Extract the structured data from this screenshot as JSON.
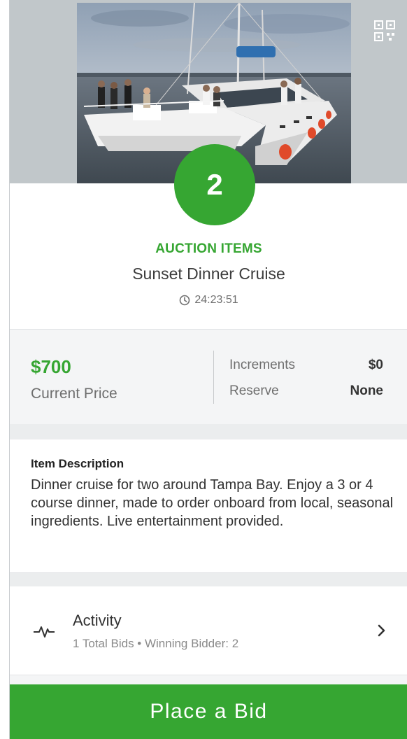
{
  "hero": {
    "image_alt": "Catamaran sailboat with guests dining on deck",
    "qr_icon": "qr-code-icon"
  },
  "item": {
    "number": "2",
    "category": "AUCTION ITEMS",
    "title": "Sunset Dinner Cruise",
    "time_remaining": "24:23:51",
    "timer_icon": "clock-icon"
  },
  "pricing": {
    "current_price": "$700",
    "current_price_label": "Current Price",
    "increments_label": "Increments",
    "increments_value": "$0",
    "reserve_label": "Reserve",
    "reserve_value": "None"
  },
  "description": {
    "heading": "Item Description",
    "body": "Dinner cruise for two around Tampa Bay. Enjoy a 3 or 4 course dinner, made to order onboard from local, seasonal ingredients. Live entertainment provided."
  },
  "activity": {
    "icon": "pulse-icon",
    "title": "Activity",
    "summary": "1 Total Bids • Winning Bidder: 2"
  },
  "actions": {
    "place_bid_label": "Place a Bid"
  },
  "colors": {
    "accent": "#36a632",
    "hero_bg": "#c1c7ca",
    "section_bg": "#f4f5f6"
  }
}
